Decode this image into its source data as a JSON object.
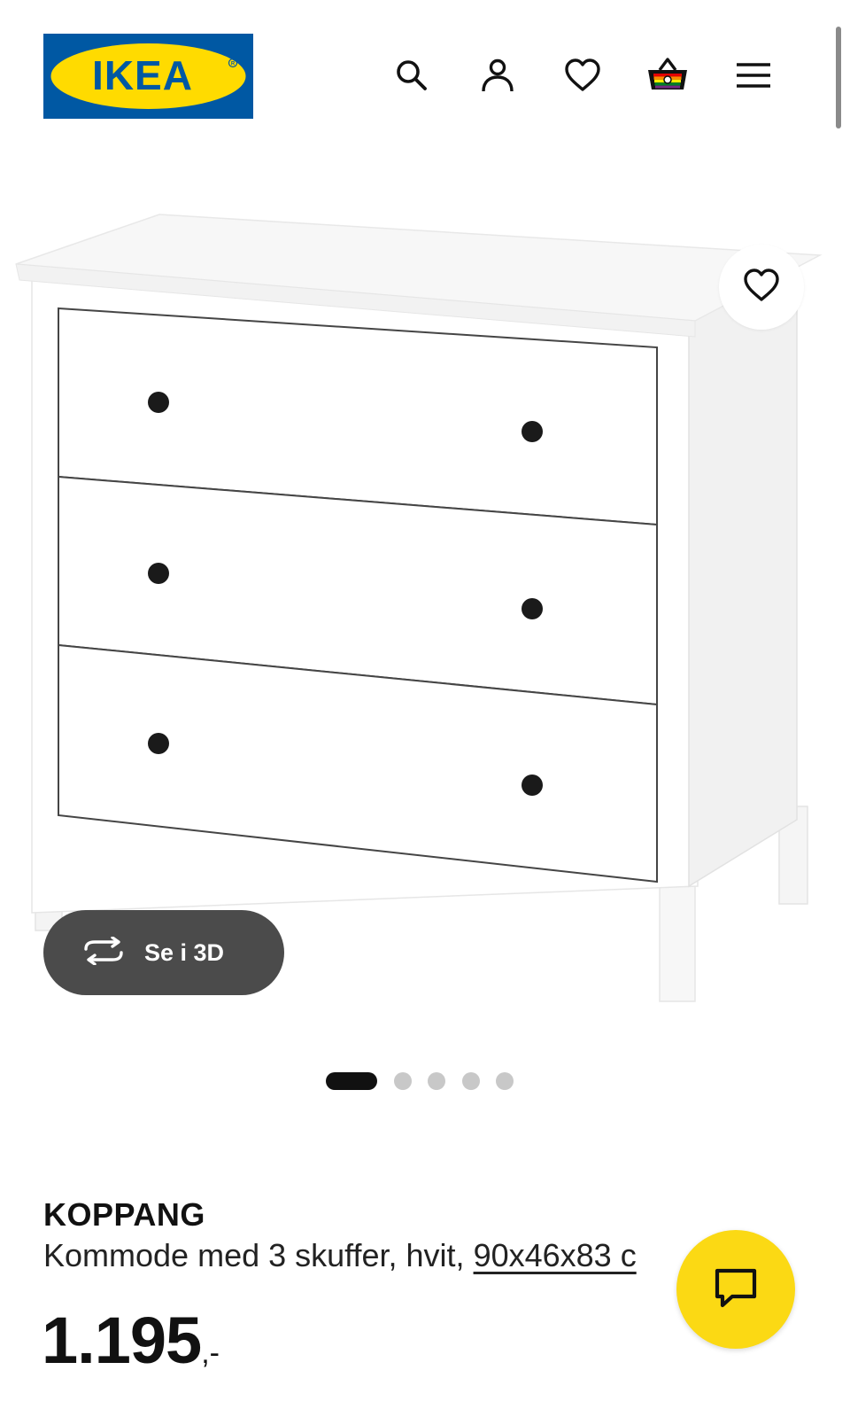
{
  "brand": {
    "logo_text": "IKEA",
    "colors": {
      "blue": "#0058a3",
      "yellow": "#ffdb00"
    }
  },
  "header": {
    "icons": [
      "search-icon",
      "account-icon",
      "favorites-icon",
      "cart-icon",
      "menu-icon"
    ]
  },
  "gallery": {
    "see_3d_label": "Se i 3D",
    "slide_count": 5,
    "active_slide": 1
  },
  "product": {
    "name": "KOPPANG",
    "description": "Kommode med 3 skuffer, hvit, ",
    "size_link": "90x46x83 c",
    "price": "1.195",
    "price_suffix": ",-"
  },
  "chat": {
    "icon": "chat-icon",
    "color": "#fbd914"
  }
}
